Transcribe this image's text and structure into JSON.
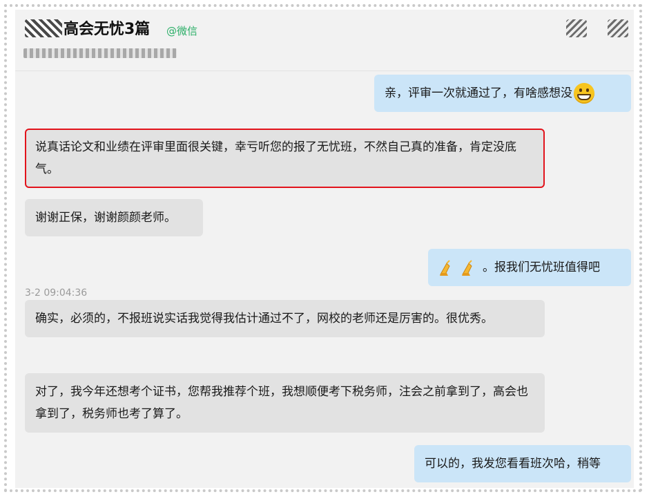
{
  "header": {
    "title": "高会无忧3篇",
    "tag": "@微信"
  },
  "messages": [
    {
      "side": "right",
      "text": "亲，评审一次就通过了，有啥感想没",
      "emoji": "grinning-face-icon"
    },
    {
      "side": "left",
      "text": "说真话论文和业绩在评审里面很关键，幸亏听您的报了无忧班，不然自己真的准备，肯定没底气。",
      "highlighted": true
    },
    {
      "side": "left",
      "text": "谢谢正保，谢谢颜颜老师。"
    },
    {
      "side": "right",
      "text": "。报我们无忧班值得吧",
      "emoji": "folded-hands-icon"
    },
    {
      "side": "left",
      "text": "确实，必须的，不报班说实话我觉得我估计通过不了，网校的老师还是厉害的。很优秀。"
    },
    {
      "side": "left",
      "text": "对了，我今年还想考个证书，您帮我推荐个班，我想顺便考下税务师，注会之前拿到了，高会也拿到了，税务师也考了算了。"
    },
    {
      "side": "right",
      "text": "可以的，我发您看看班次哈，稍等"
    }
  ],
  "timestamp": "3-2 09:04:36",
  "colors": {
    "incoming_bubble": "#e2e2e2",
    "outgoing_bubble": "#cbe5f8",
    "highlight_border": "#e2121b",
    "tag_green": "#2aae67"
  }
}
